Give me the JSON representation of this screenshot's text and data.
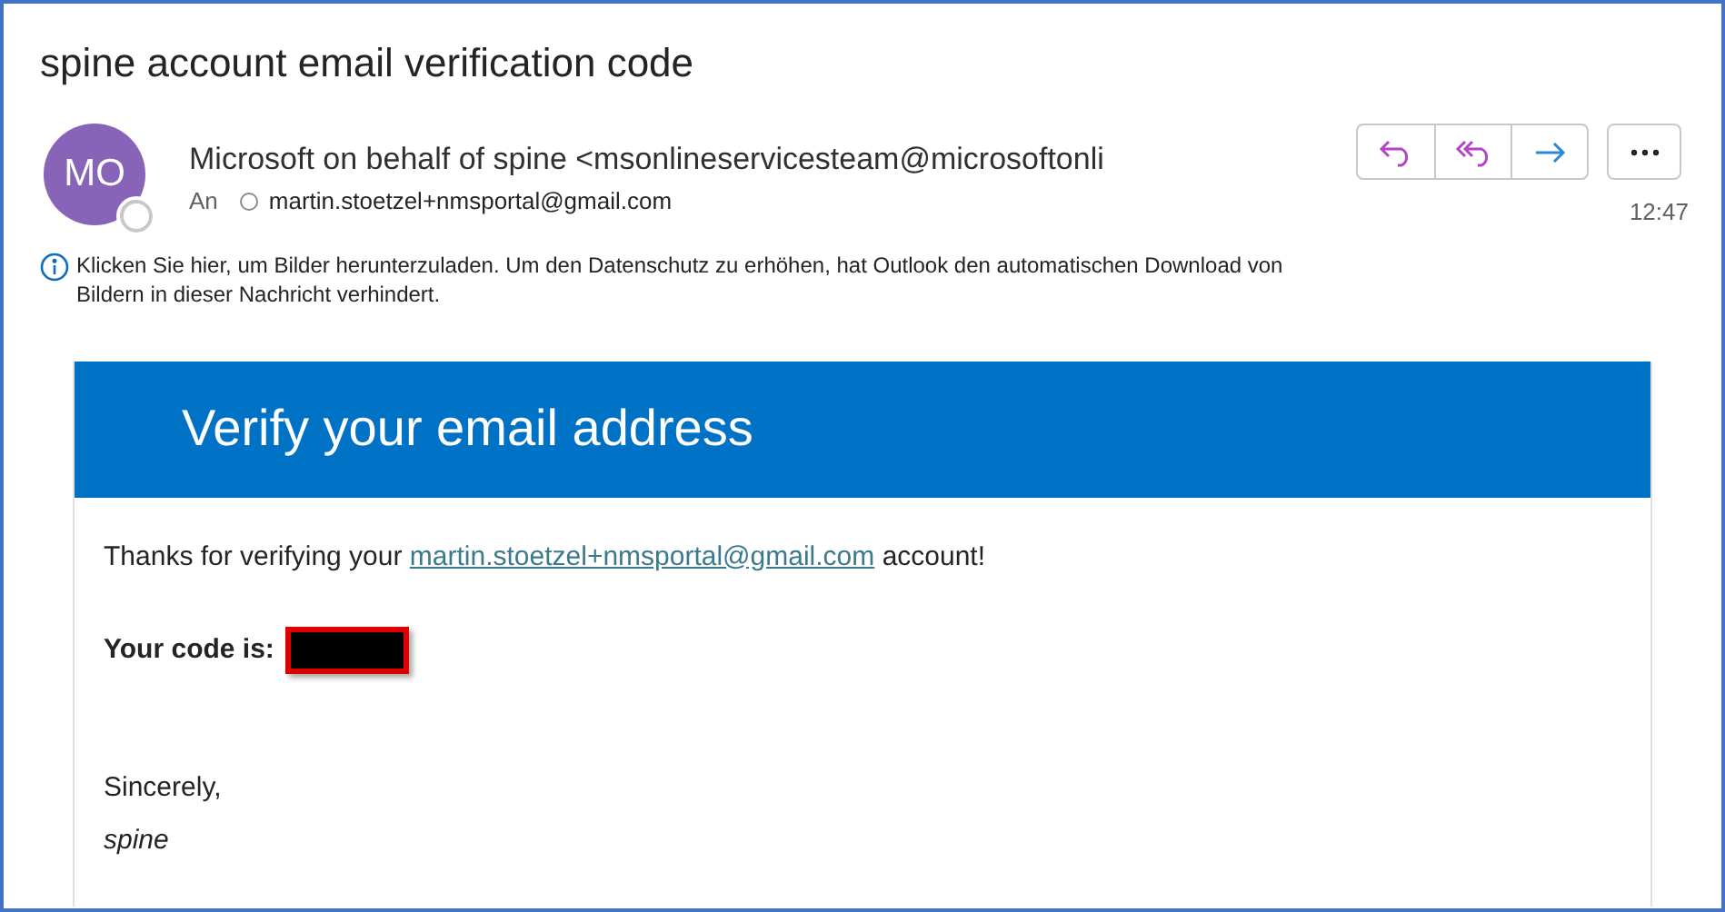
{
  "subject": "spine account email verification code",
  "avatar": {
    "initials": "MO"
  },
  "sender": "Microsoft on behalf of spine <msonlineservicesteam@microsoftonli",
  "to_label": "An",
  "recipient": "martin.stoetzel+nmsportal@gmail.com",
  "time": "12:47",
  "info": "Klicken Sie hier, um Bilder herunterzuladen. Um den Datenschutz zu erhöhen, hat Outlook den automatischen Download von Bildern in dieser Nachricht verhindert.",
  "actions": [
    {
      "kind": "reply"
    },
    {
      "kind": "reply_all"
    },
    {
      "kind": "forward"
    }
  ],
  "body": {
    "heading": "Verify your email address",
    "intro_before": "Thanks for verifying your",
    "link": "martin.stoetzel+nmsportal@gmail.com",
    "intro_after": "account!",
    "code_label": "Your code is:",
    "closing": "Sincerely,",
    "signature": "spine"
  }
}
